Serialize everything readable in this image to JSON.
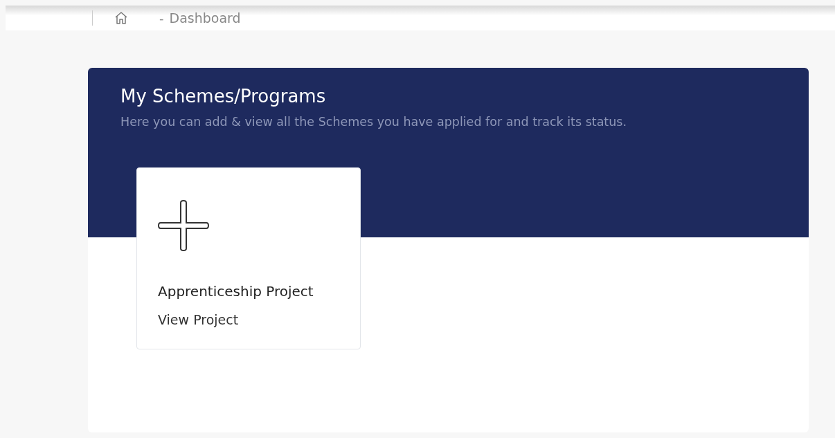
{
  "breadcrumb": {
    "separator": "-",
    "current": "Dashboard"
  },
  "header": {
    "title": "My Schemes/Programs",
    "subtitle": "Here you can add & view all the Schemes you have applied for and track its status."
  },
  "cards": [
    {
      "kind": "add",
      "title": "Apprenticeship Project",
      "link": "View Project"
    }
  ]
}
